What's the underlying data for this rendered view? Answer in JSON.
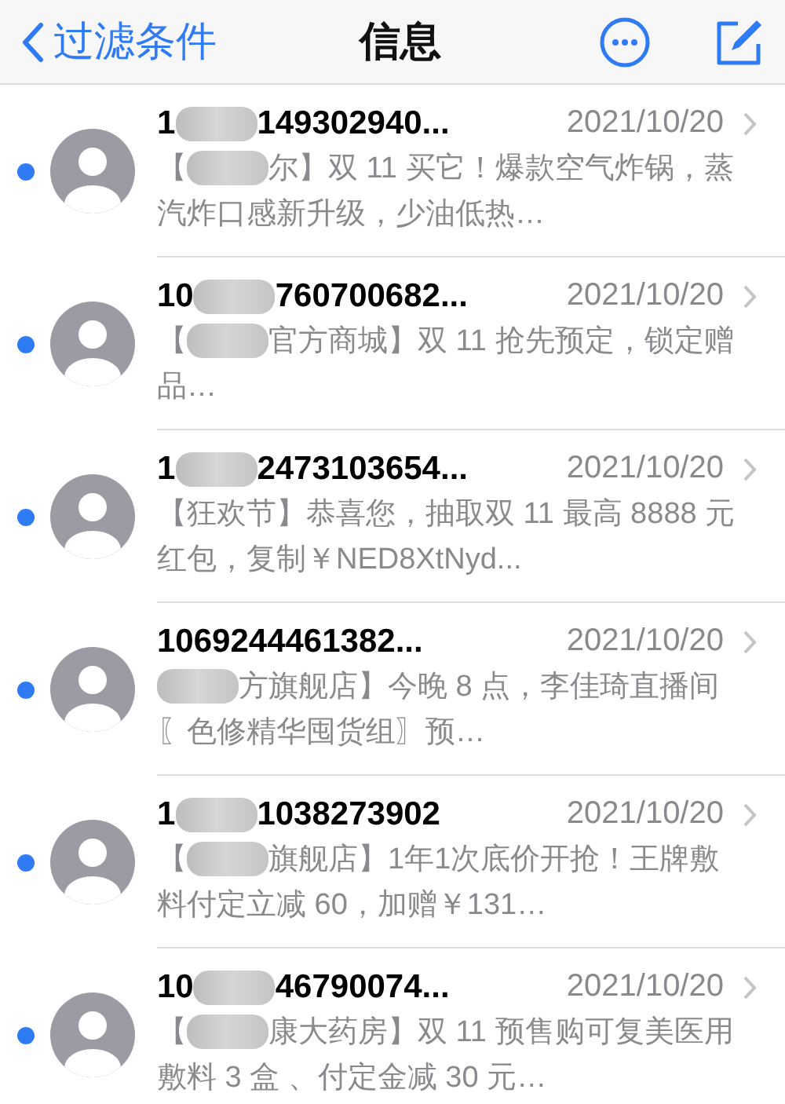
{
  "nav_bar": {
    "back_label": "过滤条件",
    "title": "信息"
  },
  "messages": [
    {
      "sender": [
        "1",
        "149302940..."
      ],
      "date": "2021/10/20",
      "preview": [
        "【",
        "尔】双 11 买它！爆款空气炸锅，蒸汽炸口感新升级，少油低热…"
      ],
      "unread": true
    },
    {
      "sender": [
        "10",
        "760700682..."
      ],
      "date": "2021/10/20",
      "preview": [
        "【",
        "官方商城】双 11 抢先预定，锁定赠品…"
      ],
      "unread": true
    },
    {
      "sender": [
        "1",
        "2473103654..."
      ],
      "date": "2021/10/20",
      "preview": [
        "【狂欢节】恭喜您，抽取双 11 最高 8888 元红包，复制￥NED8XtNyd..."
      ],
      "unread": true
    },
    {
      "sender": [
        "1069244461382..."
      ],
      "date": "2021/10/20",
      "preview_starts_redacted": true,
      "preview": [
        "方旗舰店】今晚 8 点，李佳琦直播间〖色修精华囤货组〗预…"
      ],
      "unread": true
    },
    {
      "sender": [
        "1",
        "1038273902"
      ],
      "date": "2021/10/20",
      "preview": [
        "【",
        "旗舰店】1年1次底价开抢！王牌敷料付定立减 60，加赠￥131…"
      ],
      "unread": true
    },
    {
      "sender": [
        "10",
        "46790074..."
      ],
      "date": "2021/10/20",
      "preview": [
        "【",
        "康大药房】双 11 预售购可复美医用敷料 3 盒 、付定金减 30 元…"
      ],
      "unread": true
    }
  ]
}
